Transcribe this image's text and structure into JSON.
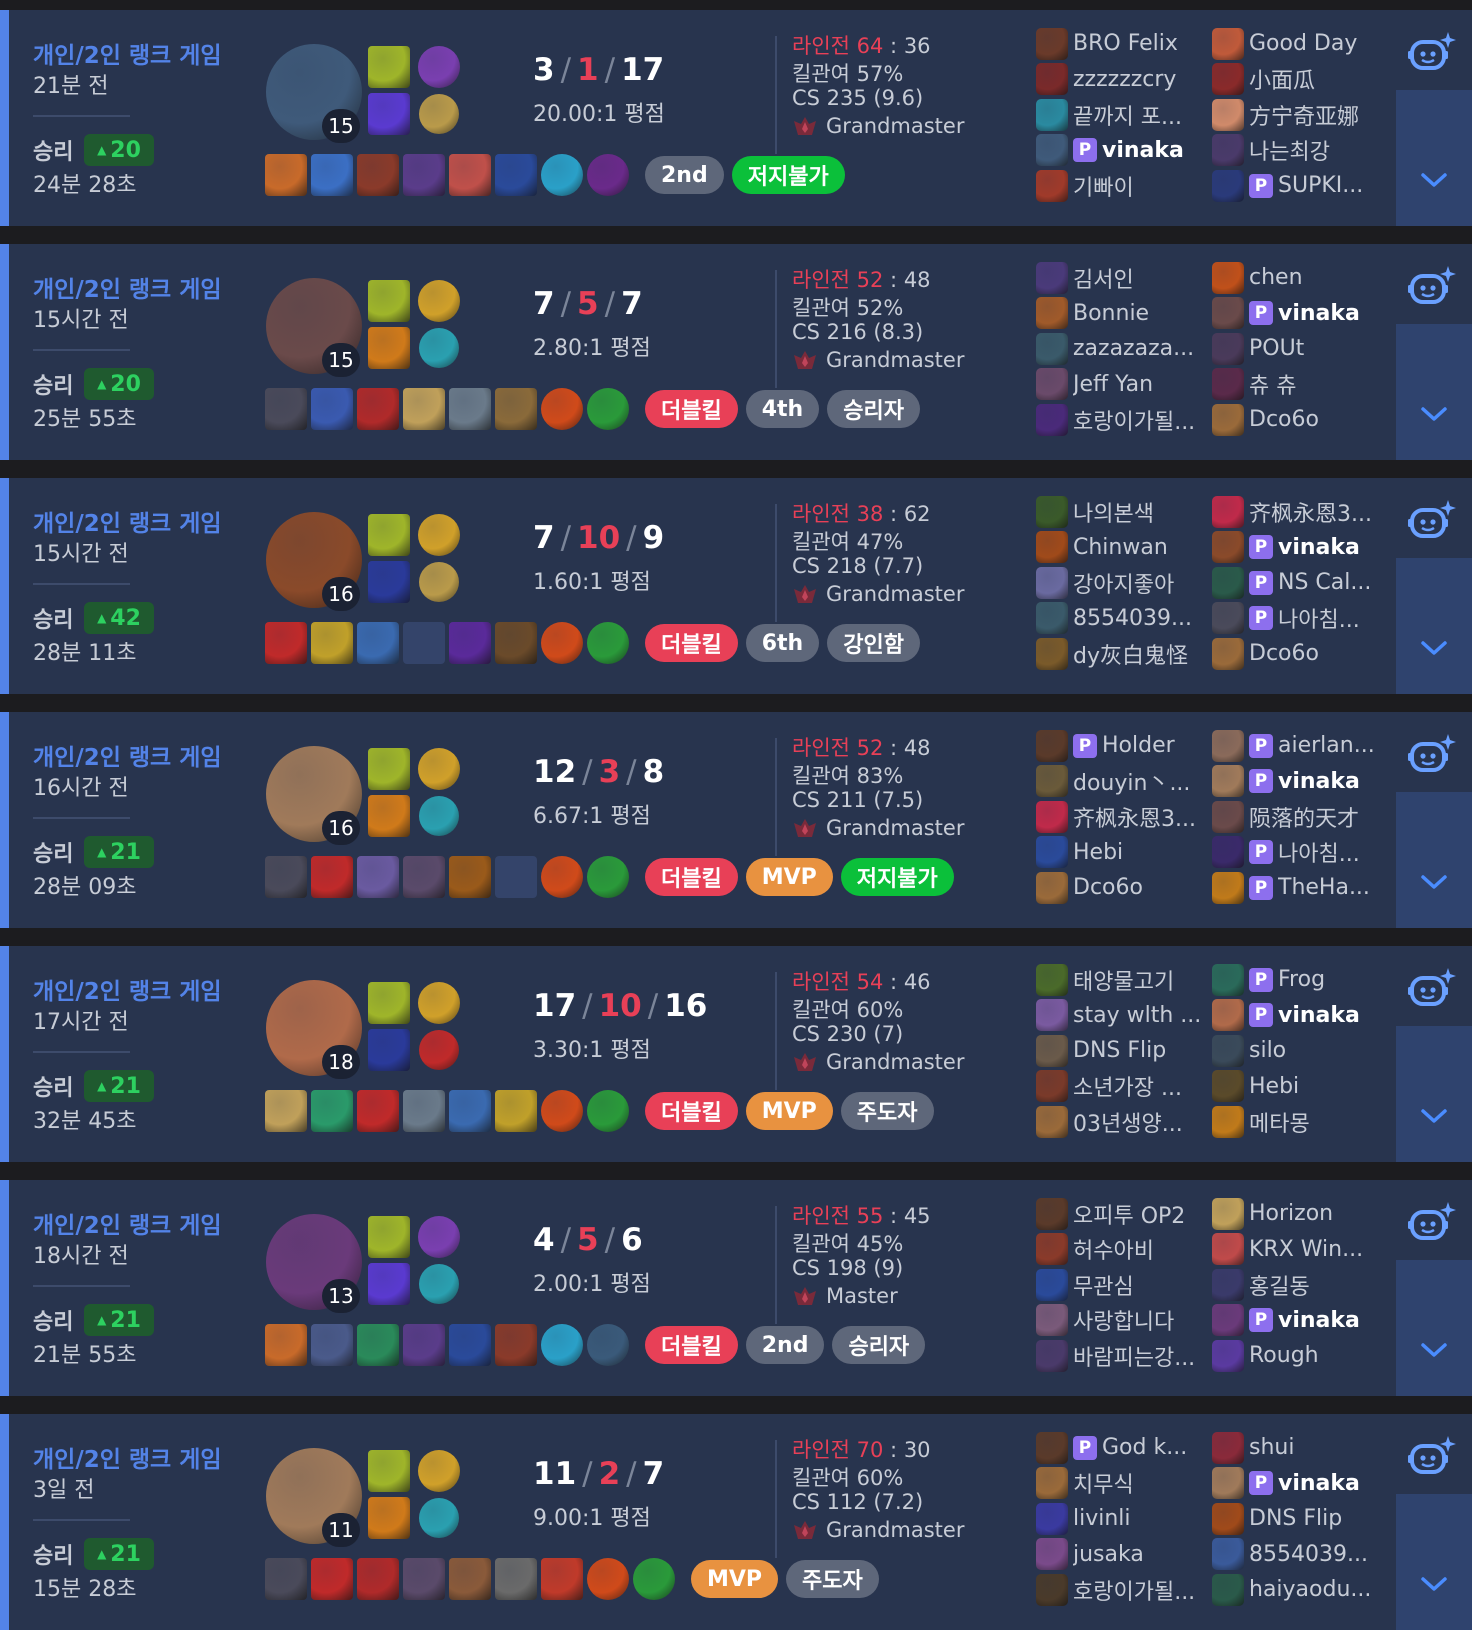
{
  "colors": {
    "win_accent": "#5383e8",
    "loss_red": "#e84057",
    "lp_green": "#2dd160",
    "mvp_orange": "#e89240",
    "unstoppable_green": "#0bc03a",
    "premium_purple": "#8d6fee"
  },
  "icons": {
    "robot": "ai-assistant-robot-icon",
    "expand": "chevron-down-icon",
    "tier": "tier-emblem-icon"
  },
  "matches": [
    {
      "queue": "개인/2인 랭크 게임",
      "ago": "21분 전",
      "result": "승리",
      "lp": "20",
      "duration": "24분 28초",
      "champ_color": "#3f5a7a",
      "level": "15",
      "spells": [
        "#9fb52a",
        "#5a3ad0"
      ],
      "runes": [
        "#7a3fb0",
        "#b99a4a"
      ],
      "kda": {
        "k": "3",
        "d": "1",
        "a": "17"
      },
      "ratio": "20.00:1 평점",
      "items": [
        "#c86a2a",
        "#3b6fc4",
        "#8a3a2a",
        "#5a3c8a",
        "#c0504a",
        "#2a4a9a",
        "#2aa0c8",
        "#6a2a8a"
      ],
      "empty_items": [],
      "badges": [
        {
          "text": "2nd",
          "kind": "gray"
        },
        {
          "text": "저지불가",
          "kind": "green"
        }
      ],
      "lane_label": "라인전",
      "lane_mine": "64",
      "lane_colon": ":",
      "lane_opp": "36",
      "kp": "킬관여 57%",
      "cs": "CS 235 (9.6)",
      "tier": "Grandmaster",
      "team1": [
        {
          "name": "BRO Felix",
          "p": false,
          "me": false,
          "c": "#6a3a2a"
        },
        {
          "name": "zzzzzzcry",
          "p": false,
          "me": false,
          "c": "#7a2a2a"
        },
        {
          "name": "끝까지 포...",
          "p": false,
          "me": false,
          "c": "#2a8aa0"
        },
        {
          "name": "vinaka",
          "p": true,
          "me": true,
          "c": "#3f5a7a"
        },
        {
          "name": "기빠이",
          "p": false,
          "me": false,
          "c": "#a03a2a"
        }
      ],
      "team2": [
        {
          "name": "Good Day",
          "p": false,
          "me": false,
          "c": "#c05a3a"
        },
        {
          "name": "小面瓜",
          "p": false,
          "me": false,
          "c": "#8a2a2a"
        },
        {
          "name": "方宁奇亚娜",
          "p": false,
          "me": false,
          "c": "#d08a6a"
        },
        {
          "name": "나는최강",
          "p": false,
          "me": false,
          "c": "#4a3a6a"
        },
        {
          "name": "SUPKI...",
          "p": true,
          "me": false,
          "c": "#2a3a7a"
        }
      ]
    },
    {
      "queue": "개인/2인 랭크 게임",
      "ago": "15시간 전",
      "result": "승리",
      "lp": "20",
      "duration": "25분 55초",
      "champ_color": "#6a4a4a",
      "level": "15",
      "spells": [
        "#9fb52a",
        "#d07a1a"
      ],
      "runes": [
        "#d0a02a",
        "#2aa0b0"
      ],
      "kda": {
        "k": "7",
        "d": "5",
        "a": "7"
      },
      "ratio": "2.80:1 평점",
      "items": [
        "#4a4a5a",
        "#3a5ab0",
        "#b02a2a",
        "#c0a05a",
        "#6a7a8a",
        "#8a6a3a",
        "#d04a1a",
        "#2a9a3a"
      ],
      "empty_items": [],
      "badges": [
        {
          "text": "더블킬",
          "kind": "red"
        },
        {
          "text": "4th",
          "kind": "gray"
        },
        {
          "text": "승리자",
          "kind": "gray"
        }
      ],
      "lane_label": "라인전",
      "lane_mine": "52",
      "lane_colon": ":",
      "lane_opp": "48",
      "kp": "킬관여 52%",
      "cs": "CS 216 (8.3)",
      "tier": "Grandmaster",
      "team1": [
        {
          "name": "김서인",
          "p": false,
          "me": false,
          "c": "#4a3a7a"
        },
        {
          "name": "Bonnie",
          "p": false,
          "me": false,
          "c": "#a05a2a"
        },
        {
          "name": "zazazaza...",
          "p": false,
          "me": false,
          "c": "#3a5a6a"
        },
        {
          "name": "Jeff Yan",
          "p": false,
          "me": false,
          "c": "#6a4a6a"
        },
        {
          "name": "호랑이가될...",
          "p": false,
          "me": false,
          "c": "#4a2a7a"
        }
      ],
      "team2": [
        {
          "name": "chen",
          "p": false,
          "me": false,
          "c": "#c0501a"
        },
        {
          "name": "vinaka",
          "p": true,
          "me": true,
          "c": "#6a4a4a"
        },
        {
          "name": "POUt",
          "p": false,
          "me": false,
          "c": "#4a3a5a"
        },
        {
          "name": "츄 츄",
          "p": false,
          "me": false,
          "c": "#5a2a4a"
        },
        {
          "name": "Dco6o",
          "p": false,
          "me": false,
          "c": "#9a6a3a"
        }
      ]
    },
    {
      "queue": "개인/2인 랭크 게임",
      "ago": "15시간 전",
      "result": "승리",
      "lp": "42",
      "duration": "28분 11초",
      "champ_color": "#8a4a2a",
      "level": "16",
      "spells": [
        "#9fb52a",
        "#2a3a9a"
      ],
      "runes": [
        "#d0a02a",
        "#b99a4a"
      ],
      "kda": {
        "k": "7",
        "d": "10",
        "a": "9"
      },
      "ratio": "1.60:1 평점",
      "items": [
        "#c02a2a",
        "#c0a02a",
        "#3a6ab0",
        null,
        "#5a2a9a",
        "#6a4a2a",
        "#d04a1a",
        "#2a9a3a"
      ],
      "empty_items": [
        3
      ],
      "badges": [
        {
          "text": "더블킬",
          "kind": "red"
        },
        {
          "text": "6th",
          "kind": "gray"
        },
        {
          "text": "강인함",
          "kind": "gray"
        }
      ],
      "lane_label": "라인전",
      "lane_mine": "38",
      "lane_colon": ":",
      "lane_opp": "62",
      "kp": "킬관여 47%",
      "cs": "CS 218 (7.7)",
      "tier": "Grandmaster",
      "team1": [
        {
          "name": "나의본색",
          "p": false,
          "me": false,
          "c": "#3a5a2a"
        },
        {
          "name": "Chinwan",
          "p": false,
          "me": false,
          "c": "#a04a1a"
        },
        {
          "name": "강아지좋아",
          "p": false,
          "me": false,
          "c": "#6a6aa0"
        },
        {
          "name": "8554039...",
          "p": false,
          "me": false,
          "c": "#3a5a6a"
        },
        {
          "name": "dy灰白鬼怪",
          "p": false,
          "me": false,
          "c": "#7a5a2a"
        }
      ],
      "team2": [
        {
          "name": "齐枫永恩3...",
          "p": false,
          "me": false,
          "c": "#c02a4a"
        },
        {
          "name": "vinaka",
          "p": true,
          "me": true,
          "c": "#8a4a2a"
        },
        {
          "name": "NS Cal...",
          "p": true,
          "me": false,
          "c": "#2a5a4a"
        },
        {
          "name": "나아침...",
          "p": true,
          "me": false,
          "c": "#4a4a5a"
        },
        {
          "name": "Dco6o",
          "p": false,
          "me": false,
          "c": "#9a6a3a"
        }
      ]
    },
    {
      "queue": "개인/2인 랭크 게임",
      "ago": "16시간 전",
      "result": "승리",
      "lp": "21",
      "duration": "28분 09초",
      "champ_color": "#a07a5a",
      "level": "16",
      "spells": [
        "#9fb52a",
        "#d07a1a"
      ],
      "runes": [
        "#d0a02a",
        "#2aa0b0"
      ],
      "kda": {
        "k": "12",
        "d": "3",
        "a": "8"
      },
      "ratio": "6.67:1 평점",
      "items": [
        "#4a4a5a",
        "#c02a2a",
        "#6a5aa0",
        "#5a4a6a",
        "#9a5a1a",
        null,
        "#d04a1a",
        "#2a9a3a"
      ],
      "empty_items": [
        5
      ],
      "badges": [
        {
          "text": "더블킬",
          "kind": "red"
        },
        {
          "text": "MVP",
          "kind": "orange"
        },
        {
          "text": "저지불가",
          "kind": "green"
        }
      ],
      "lane_label": "라인전",
      "lane_mine": "52",
      "lane_colon": ":",
      "lane_opp": "48",
      "kp": "킬관여 83%",
      "cs": "CS 211 (7.5)",
      "tier": "Grandmaster",
      "team1": [
        {
          "name": "Holder",
          "p": true,
          "me": false,
          "c": "#5a3a2a"
        },
        {
          "name": "douyin丶...",
          "p": false,
          "me": false,
          "c": "#6a5a3a"
        },
        {
          "name": "齐枫永恩3...",
          "p": false,
          "me": false,
          "c": "#c02a4a"
        },
        {
          "name": "Hebi",
          "p": false,
          "me": false,
          "c": "#2a4a9a"
        },
        {
          "name": "Dco6o",
          "p": false,
          "me": false,
          "c": "#9a6a3a"
        }
      ],
      "team2": [
        {
          "name": "aierlan...",
          "p": true,
          "me": false,
          "c": "#8a6a5a"
        },
        {
          "name": "vinaka",
          "p": true,
          "me": true,
          "c": "#a07a5a"
        },
        {
          "name": "陨落的天才",
          "p": false,
          "me": false,
          "c": "#6a4a4a"
        },
        {
          "name": "나아침...",
          "p": true,
          "me": false,
          "c": "#3a2a6a"
        },
        {
          "name": "TheHa...",
          "p": true,
          "me": false,
          "c": "#c07a1a"
        }
      ]
    },
    {
      "queue": "개인/2인 랭크 게임",
      "ago": "17시간 전",
      "result": "승리",
      "lp": "21",
      "duration": "32분 45초",
      "champ_color": "#b06a4a",
      "level": "18",
      "spells": [
        "#9fb52a",
        "#2a3a9a"
      ],
      "runes": [
        "#d0a02a",
        "#c02a2a"
      ],
      "kda": {
        "k": "17",
        "d": "10",
        "a": "16"
      },
      "ratio": "3.30:1 평점",
      "items": [
        "#c0a05a",
        "#2a9a6a",
        "#c02a2a",
        "#6a7a8a",
        "#3a6ab0",
        "#c0a02a",
        "#d04a1a",
        "#2a9a3a"
      ],
      "empty_items": [],
      "badges": [
        {
          "text": "더블킬",
          "kind": "red"
        },
        {
          "text": "MVP",
          "kind": "orange"
        },
        {
          "text": "주도자",
          "kind": "gray"
        }
      ],
      "lane_label": "라인전",
      "lane_mine": "54",
      "lane_colon": ":",
      "lane_opp": "46",
      "kp": "킬관여 60%",
      "cs": "CS 230 (7)",
      "tier": "Grandmaster",
      "team1": [
        {
          "name": "태양물고기",
          "p": false,
          "me": false,
          "c": "#4a6a2a"
        },
        {
          "name": "stay wlth ...",
          "p": false,
          "me": false,
          "c": "#7a5aa0"
        },
        {
          "name": "DNS Flip",
          "p": false,
          "me": false,
          "c": "#6a5a4a"
        },
        {
          "name": "소년가장 ...",
          "p": false,
          "me": false,
          "c": "#7a3a2a"
        },
        {
          "name": "03년생양...",
          "p": false,
          "me": false,
          "c": "#9a6a3a"
        }
      ],
      "team2": [
        {
          "name": "Frog",
          "p": true,
          "me": false,
          "c": "#2a6a5a"
        },
        {
          "name": "vinaka",
          "p": true,
          "me": true,
          "c": "#b06a4a"
        },
        {
          "name": "silo",
          "p": false,
          "me": false,
          "c": "#3a4a5a"
        },
        {
          "name": "Hebi",
          "p": false,
          "me": false,
          "c": "#5a4a2a"
        },
        {
          "name": "메타몽",
          "p": false,
          "me": false,
          "c": "#c07a1a"
        }
      ]
    },
    {
      "queue": "개인/2인 랭크 게임",
      "ago": "18시간 전",
      "result": "승리",
      "lp": "21",
      "duration": "21분 55초",
      "champ_color": "#6a3a7a",
      "level": "13",
      "spells": [
        "#9fb52a",
        "#5a3ad0"
      ],
      "runes": [
        "#7a3fb0",
        "#2aa0b0"
      ],
      "kda": {
        "k": "4",
        "d": "5",
        "a": "6"
      },
      "ratio": "2.00:1 평점",
      "items": [
        "#c86a2a",
        "#4a5a8a",
        "#2a8a5a",
        "#5a3c8a",
        "#2a4a9a",
        "#8a3a2a",
        "#2aa0c8",
        "#3a5a7a"
      ],
      "empty_items": [],
      "badges": [
        {
          "text": "더블킬",
          "kind": "red"
        },
        {
          "text": "2nd",
          "kind": "gray"
        },
        {
          "text": "승리자",
          "kind": "gray"
        }
      ],
      "lane_label": "라인전",
      "lane_mine": "55",
      "lane_colon": ":",
      "lane_opp": "45",
      "kp": "킬관여 45%",
      "cs": "CS 198 (9)",
      "tier": "Master",
      "team1": [
        {
          "name": "오피투 OP2",
          "p": false,
          "me": false,
          "c": "#5a3a2a"
        },
        {
          "name": "허수아비",
          "p": false,
          "me": false,
          "c": "#8a3a2a"
        },
        {
          "name": "무관심",
          "p": false,
          "me": false,
          "c": "#2a4a9a"
        },
        {
          "name": "사랑합니다",
          "p": false,
          "me": false,
          "c": "#7a5a7a"
        },
        {
          "name": "바람피는강...",
          "p": false,
          "me": false,
          "c": "#4a3a6a"
        }
      ],
      "team2": [
        {
          "name": "Horizon",
          "p": false,
          "me": false,
          "c": "#c0a05a"
        },
        {
          "name": "KRX Win...",
          "p": false,
          "me": false,
          "c": "#c04a4a"
        },
        {
          "name": "홍길동",
          "p": false,
          "me": false,
          "c": "#3a3a6a"
        },
        {
          "name": "vinaka",
          "p": true,
          "me": true,
          "c": "#6a3a7a"
        },
        {
          "name": "Rough",
          "p": false,
          "me": false,
          "c": "#5a3aa0"
        }
      ]
    },
    {
      "queue": "개인/2인 랭크 게임",
      "ago": "3일 전",
      "result": "승리",
      "lp": "21",
      "duration": "15분 28초",
      "champ_color": "#a07a5a",
      "level": "11",
      "spells": [
        "#9fb52a",
        "#d07a1a"
      ],
      "runes": [
        "#d0a02a",
        "#2aa0b0"
      ],
      "kda": {
        "k": "11",
        "d": "2",
        "a": "7"
      },
      "ratio": "9.00:1 평점",
      "items": [
        "#4a4a5a",
        "#c02a2a",
        "#b02a2a",
        "#5a4a6a",
        "#8a5a3a",
        "#6a6a6a",
        "#c03a2a",
        "#d04a1a",
        "#2a9a3a"
      ],
      "empty_items": [],
      "badges": [
        {
          "text": "MVP",
          "kind": "orange"
        },
        {
          "text": "주도자",
          "kind": "gray"
        }
      ],
      "lane_label": "라인전",
      "lane_mine": "70",
      "lane_colon": ":",
      "lane_opp": "30",
      "kp": "킬관여 60%",
      "cs": "CS 112 (7.2)",
      "tier": "Grandmaster",
      "team1": [
        {
          "name": "God k...",
          "p": true,
          "me": false,
          "c": "#5a3a2a"
        },
        {
          "name": "치무식",
          "p": false,
          "me": false,
          "c": "#9a6a3a"
        },
        {
          "name": "livinli",
          "p": false,
          "me": false,
          "c": "#3a3aa0"
        },
        {
          "name": "jusaka",
          "p": false,
          "me": false,
          "c": "#7a4a8a"
        },
        {
          "name": "호랑이가될...",
          "p": false,
          "me": false,
          "c": "#4a3a2a"
        }
      ],
      "team2": [
        {
          "name": "shui",
          "p": false,
          "me": false,
          "c": "#8a2a3a"
        },
        {
          "name": "vinaka",
          "p": true,
          "me": true,
          "c": "#a07a5a"
        },
        {
          "name": "DNS Flip",
          "p": false,
          "me": false,
          "c": "#a04a1a"
        },
        {
          "name": "8554039...",
          "p": false,
          "me": false,
          "c": "#3a5a9a"
        },
        {
          "name": "haiyaodu...",
          "p": false,
          "me": false,
          "c": "#2a5a4a"
        }
      ]
    }
  ]
}
